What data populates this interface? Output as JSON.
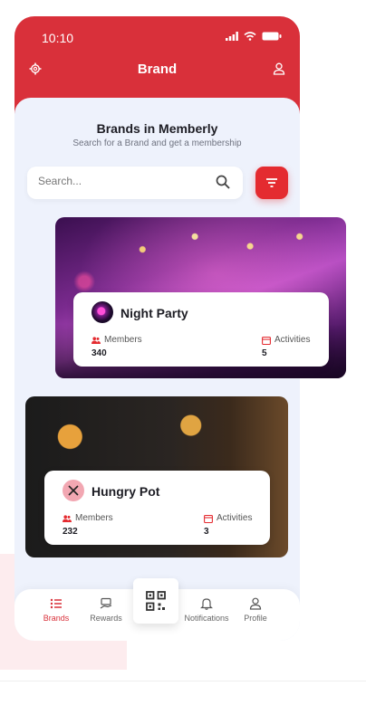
{
  "status": {
    "time": "10:10"
  },
  "header": {
    "title": "Brand"
  },
  "hero": {
    "title": "Brands in Memberly",
    "subtitle": "Search for a Brand and get a membership"
  },
  "search": {
    "placeholder": "Search..."
  },
  "brands": [
    {
      "name": "Night Party",
      "members_label": "Members",
      "members": "340",
      "activities_label": "Activities",
      "activities": "5"
    },
    {
      "name": "Hungry Pot",
      "members_label": "Members",
      "members": "232",
      "activities_label": "Activities",
      "activities": "3"
    }
  ],
  "nav": {
    "items": [
      {
        "label": "Brands",
        "icon": "list-icon",
        "active": true
      },
      {
        "label": "Rewards",
        "icon": "reward-icon"
      },
      {
        "label": "",
        "icon": "qr-code-icon"
      },
      {
        "label": "Notifications",
        "icon": "bell-icon"
      },
      {
        "label": "Profile",
        "icon": "user-icon"
      }
    ]
  },
  "colors": {
    "primary": "#d9303a",
    "background": "#eef2fc",
    "accent": "#e42b30"
  }
}
